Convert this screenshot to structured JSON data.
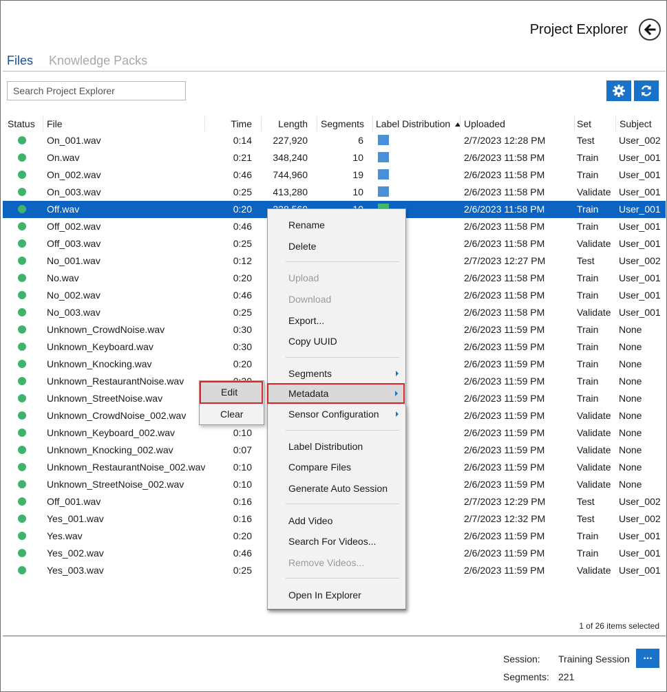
{
  "header": {
    "title": "Project Explorer"
  },
  "tabs": [
    {
      "label": "Files"
    },
    {
      "label": "Knowledge Packs"
    }
  ],
  "search": {
    "placeholder": "Search Project Explorer"
  },
  "icons": {
    "back": "arrow-left-icon",
    "settings": "gear-icon",
    "refresh": "refresh-icon",
    "status": "status-dot-icon",
    "sort": "sort-ascending-icon"
  },
  "colors": {
    "accent": "#1a73c8",
    "selection": "#0c63c2",
    "status_ok": "#3eb36a",
    "label_blue": "#4a90d9",
    "label_green": "#3fb86e",
    "highlight": "#d9232d"
  },
  "columns": {
    "status": "Status",
    "file": "File",
    "time": "Time",
    "length": "Length",
    "segments": "Segments",
    "label_distribution": "Label Distribution",
    "uploaded": "Uploaded",
    "set": "Set",
    "subject": "Subject"
  },
  "files": [
    {
      "file": "On_001.wav",
      "time": "0:14",
      "length": "227,920",
      "segments": "6",
      "label_color": "#4a90d9",
      "uploaded": "2/7/2023 12:28 PM",
      "set": "Test",
      "subject": "User_002"
    },
    {
      "file": "On.wav",
      "time": "0:21",
      "length": "348,240",
      "segments": "10",
      "label_color": "#4a90d9",
      "uploaded": "2/6/2023 11:58 PM",
      "set": "Train",
      "subject": "User_001"
    },
    {
      "file": "On_002.wav",
      "time": "0:46",
      "length": "744,960",
      "segments": "19",
      "label_color": "#4a90d9",
      "uploaded": "2/6/2023 11:58 PM",
      "set": "Train",
      "subject": "User_001"
    },
    {
      "file": "On_003.wav",
      "time": "0:25",
      "length": "413,280",
      "segments": "10",
      "label_color": "#4a90d9",
      "uploaded": "2/6/2023 11:58 PM",
      "set": "Validate",
      "subject": "User_001"
    },
    {
      "file": "Off.wav",
      "time": "0:20",
      "length": "328,560",
      "segments": "10",
      "label_color": "#3fb86e",
      "uploaded": "2/6/2023 11:58 PM",
      "set": "Train",
      "subject": "User_001",
      "selected": true
    },
    {
      "file": "Off_002.wav",
      "time": "0:46",
      "length": "",
      "segments": "",
      "label_color": "",
      "uploaded": "2/6/2023 11:58 PM",
      "set": "Train",
      "subject": "User_001"
    },
    {
      "file": "Off_003.wav",
      "time": "0:25",
      "length": "",
      "segments": "",
      "label_color": "",
      "uploaded": "2/6/2023 11:58 PM",
      "set": "Validate",
      "subject": "User_001"
    },
    {
      "file": "No_001.wav",
      "time": "0:12",
      "length": "",
      "segments": "",
      "label_color": "",
      "uploaded": "2/7/2023 12:27 PM",
      "set": "Test",
      "subject": "User_002"
    },
    {
      "file": "No.wav",
      "time": "0:20",
      "length": "",
      "segments": "",
      "label_color": "",
      "uploaded": "2/6/2023 11:58 PM",
      "set": "Train",
      "subject": "User_001"
    },
    {
      "file": "No_002.wav",
      "time": "0:46",
      "length": "",
      "segments": "",
      "label_color": "",
      "uploaded": "2/6/2023 11:58 PM",
      "set": "Train",
      "subject": "User_001"
    },
    {
      "file": "No_003.wav",
      "time": "0:25",
      "length": "",
      "segments": "",
      "label_color": "",
      "uploaded": "2/6/2023 11:58 PM",
      "set": "Validate",
      "subject": "User_001"
    },
    {
      "file": "Unknown_CrowdNoise.wav",
      "time": "0:30",
      "length": "",
      "segments": "",
      "label_color": "",
      "uploaded": "2/6/2023 11:59 PM",
      "set": "Train",
      "subject": "None"
    },
    {
      "file": "Unknown_Keyboard.wav",
      "time": "0:30",
      "length": "",
      "segments": "",
      "label_color": "",
      "uploaded": "2/6/2023 11:59 PM",
      "set": "Train",
      "subject": "None"
    },
    {
      "file": "Unknown_Knocking.wav",
      "time": "0:20",
      "length": "",
      "segments": "",
      "label_color": "",
      "uploaded": "2/6/2023 11:59 PM",
      "set": "Train",
      "subject": "None"
    },
    {
      "file": "Unknown_RestaurantNoise.wav",
      "time": "0:30",
      "length": "",
      "segments": "",
      "label_color": "",
      "uploaded": "2/6/2023 11:59 PM",
      "set": "Train",
      "subject": "None"
    },
    {
      "file": "Unknown_StreetNoise.wav",
      "time": "",
      "length": "",
      "segments": "",
      "label_color": "",
      "uploaded": "2/6/2023 11:59 PM",
      "set": "Train",
      "subject": "None"
    },
    {
      "file": "Unknown_CrowdNoise_002.wav",
      "time": "",
      "length": "",
      "segments": "",
      "label_color": "",
      "uploaded": "2/6/2023 11:59 PM",
      "set": "Validate",
      "subject": "None"
    },
    {
      "file": "Unknown_Keyboard_002.wav",
      "time": "0:10",
      "length": "",
      "segments": "",
      "label_color": "",
      "uploaded": "2/6/2023 11:59 PM",
      "set": "Validate",
      "subject": "None"
    },
    {
      "file": "Unknown_Knocking_002.wav",
      "time": "0:07",
      "length": "",
      "segments": "",
      "label_color": "",
      "uploaded": "2/6/2023 11:59 PM",
      "set": "Validate",
      "subject": "None"
    },
    {
      "file": "Unknown_RestaurantNoise_002.wav",
      "time": "0:10",
      "length": "",
      "segments": "",
      "label_color": "",
      "uploaded": "2/6/2023 11:59 PM",
      "set": "Validate",
      "subject": "None"
    },
    {
      "file": "Unknown_StreetNoise_002.wav",
      "time": "0:10",
      "length": "",
      "segments": "",
      "label_color": "",
      "uploaded": "2/6/2023 11:59 PM",
      "set": "Validate",
      "subject": "None"
    },
    {
      "file": "Off_001.wav",
      "time": "0:16",
      "length": "",
      "segments": "",
      "label_color": "",
      "uploaded": "2/7/2023 12:29 PM",
      "set": "Test",
      "subject": "User_002"
    },
    {
      "file": "Yes_001.wav",
      "time": "0:16",
      "length": "",
      "segments": "",
      "label_color": "",
      "uploaded": "2/7/2023 12:32 PM",
      "set": "Test",
      "subject": "User_002"
    },
    {
      "file": "Yes.wav",
      "time": "0:20",
      "length": "",
      "segments": "",
      "label_color": "",
      "uploaded": "2/6/2023 11:59 PM",
      "set": "Train",
      "subject": "User_001"
    },
    {
      "file": "Yes_002.wav",
      "time": "0:46",
      "length": "",
      "segments": "",
      "label_color": "",
      "uploaded": "2/6/2023 11:59 PM",
      "set": "Train",
      "subject": "User_001"
    },
    {
      "file": "Yes_003.wav",
      "time": "0:25",
      "length": "",
      "segments": "",
      "label_color": "",
      "uploaded": "2/6/2023 11:59 PM",
      "set": "Validate",
      "subject": "User_001"
    }
  ],
  "context_menu": {
    "rename": "Rename",
    "delete": "Delete",
    "upload": "Upload",
    "download": "Download",
    "export": "Export...",
    "copy_uuid": "Copy UUID",
    "segments": "Segments",
    "metadata": "Metadata",
    "sensor_configuration": "Sensor Configuration",
    "label_distribution": "Label Distribution",
    "compare_files": "Compare Files",
    "generate_auto_session": "Generate Auto Session",
    "add_video": "Add Video",
    "search_for_videos": "Search For Videos...",
    "remove_videos": "Remove Videos...",
    "open_in_explorer": "Open In Explorer"
  },
  "submenu": {
    "edit": "Edit",
    "clear": "Clear"
  },
  "status": {
    "selection": "1 of 26 items selected"
  },
  "footer": {
    "session_label": "Session:",
    "session_value": "Training Session",
    "segments_label": "Segments:",
    "segments_value": "221",
    "more_button": "..."
  }
}
